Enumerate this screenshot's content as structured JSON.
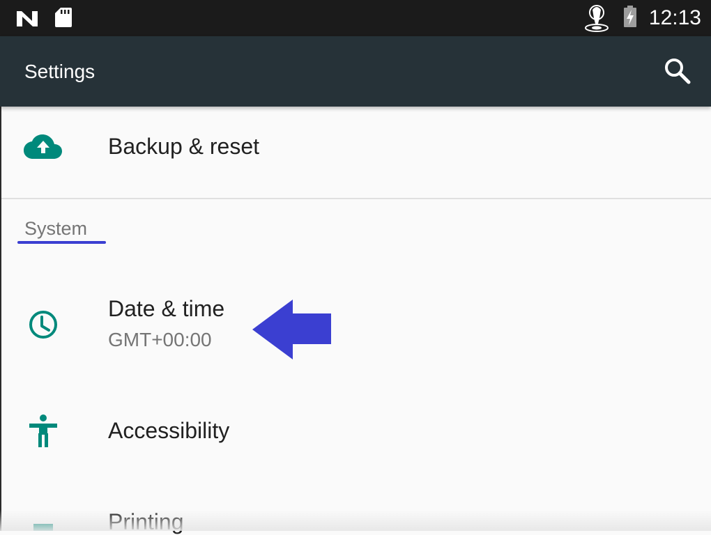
{
  "status_bar": {
    "time": "12:13",
    "icons": [
      "n-notification-icon",
      "sd-card-icon",
      "touch-tap-icon",
      "battery-charging-icon"
    ]
  },
  "toolbar": {
    "title": "Settings",
    "search_icon": "search-icon"
  },
  "colors": {
    "status_bar": "#1b1b1b",
    "toolbar": "#263238",
    "accent_teal": "#00897b",
    "annotation_blue": "#3b3fd1",
    "background": "#fafafa"
  },
  "items": {
    "backup": {
      "title": "Backup & reset",
      "icon": "cloud-upload-icon"
    },
    "category_system": "System",
    "date_time": {
      "title": "Date & time",
      "summary": "GMT+00:00",
      "icon": "clock-icon"
    },
    "accessibility": {
      "title": "Accessibility",
      "icon": "accessibility-icon"
    },
    "printing": {
      "title": "Printing",
      "icon": "print-icon"
    }
  }
}
